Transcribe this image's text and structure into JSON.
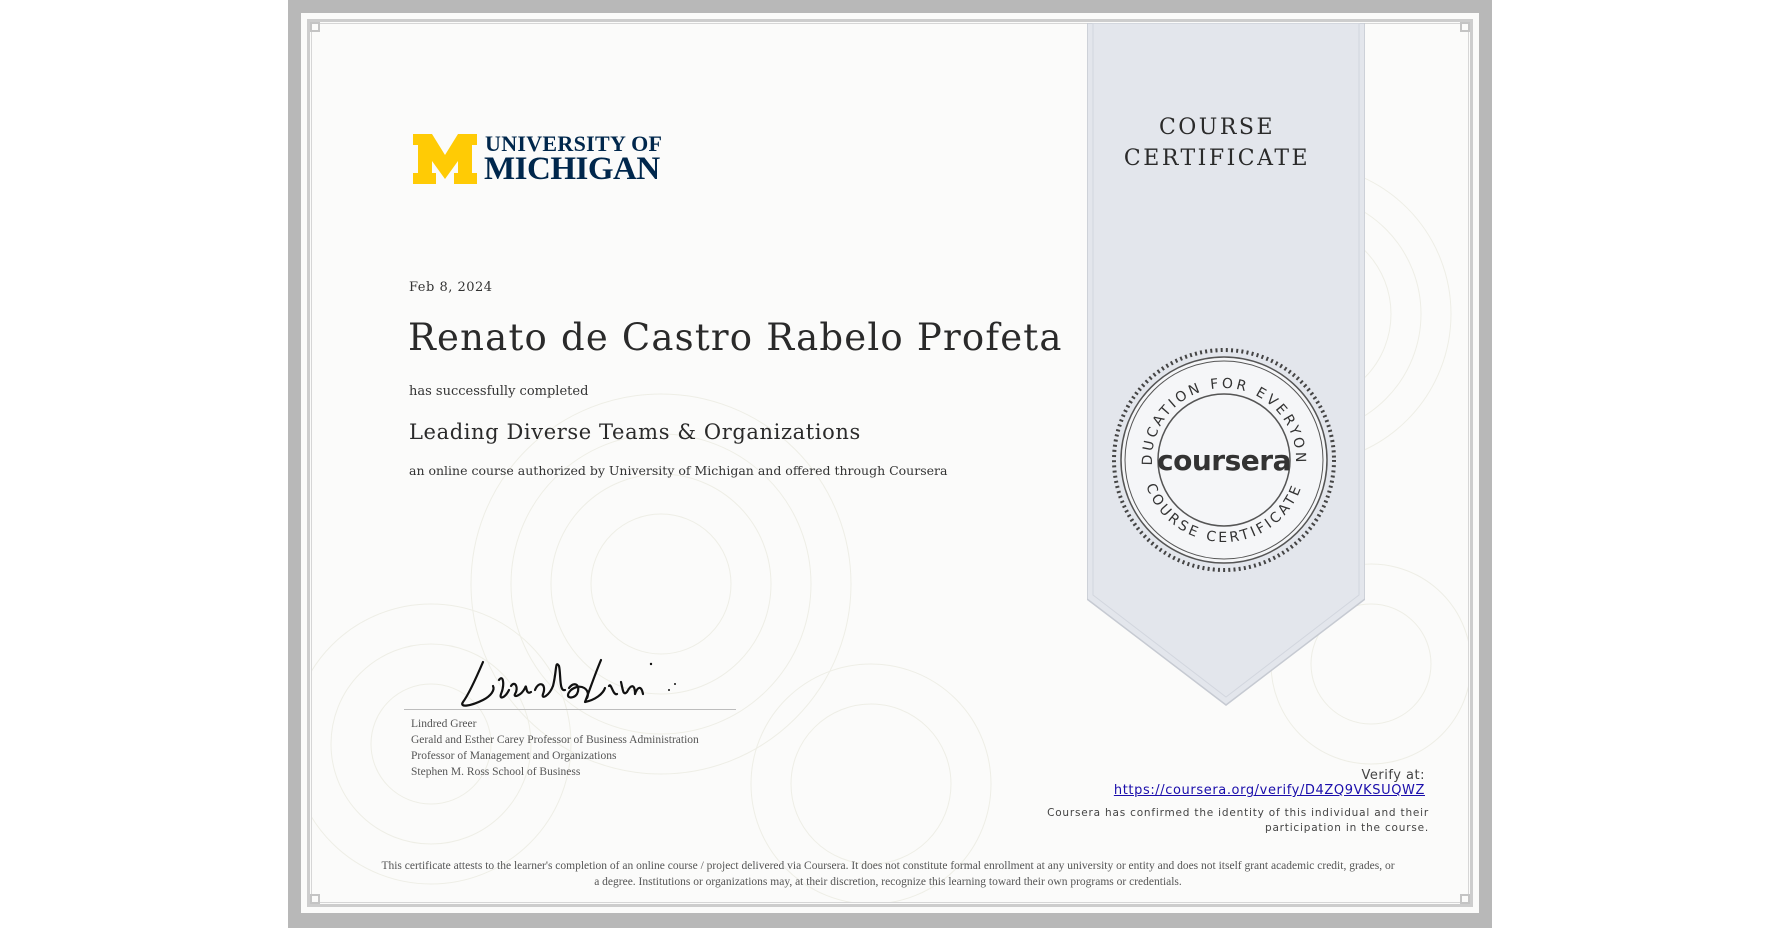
{
  "institution": {
    "logo_line1": "UNIVERSITY OF",
    "logo_line2": "MICHIGAN",
    "brand_colors": {
      "maize": "#ffcb05",
      "blue": "#00274c"
    }
  },
  "certificate": {
    "ribbon_title_line1": "COURSE",
    "ribbon_title_line2": "CERTIFICATE",
    "date": "Feb 8, 2024",
    "recipient_name": "Renato de Castro Rabelo Profeta",
    "completed_text": "has successfully completed",
    "course_title": "Leading Diverse Teams & Organizations",
    "authorized_text": "an online course authorized by University of Michigan and offered through Coursera"
  },
  "signatory": {
    "name": "Lindred Greer",
    "title_line1": "Gerald and Esther Carey Professor of Business Administration",
    "title_line2": "Professor of Management and Organizations",
    "title_line3": "Stephen M. Ross School of Business"
  },
  "seal": {
    "top_text": "EDUCATION FOR EVERYONE",
    "bottom_text": "COURSE CERTIFICATE",
    "brand": "coursera"
  },
  "verification": {
    "label": "Verify at:",
    "url": "https://coursera.org/verify/D4ZQ9VKSUQWZ",
    "confirm_line1": "Coursera has confirmed the identity of this individual and their",
    "confirm_line2": "participation in the course."
  },
  "footer": {
    "attest_line1": "This certificate attests to the learner's completion of an online course / project delivered via Coursera. It does not constitute formal enrollment at any university or entity and does not itself grant academic credit, grades, or",
    "attest_line2": "a degree. Institutions or organizations may, at their discretion, recognize this learning toward their own programs or credentials."
  },
  "colors": {
    "ribbon_fill": "#e3e6ec",
    "frame_gray": "#b8b8b8",
    "link_blue": "#1a0dab"
  }
}
